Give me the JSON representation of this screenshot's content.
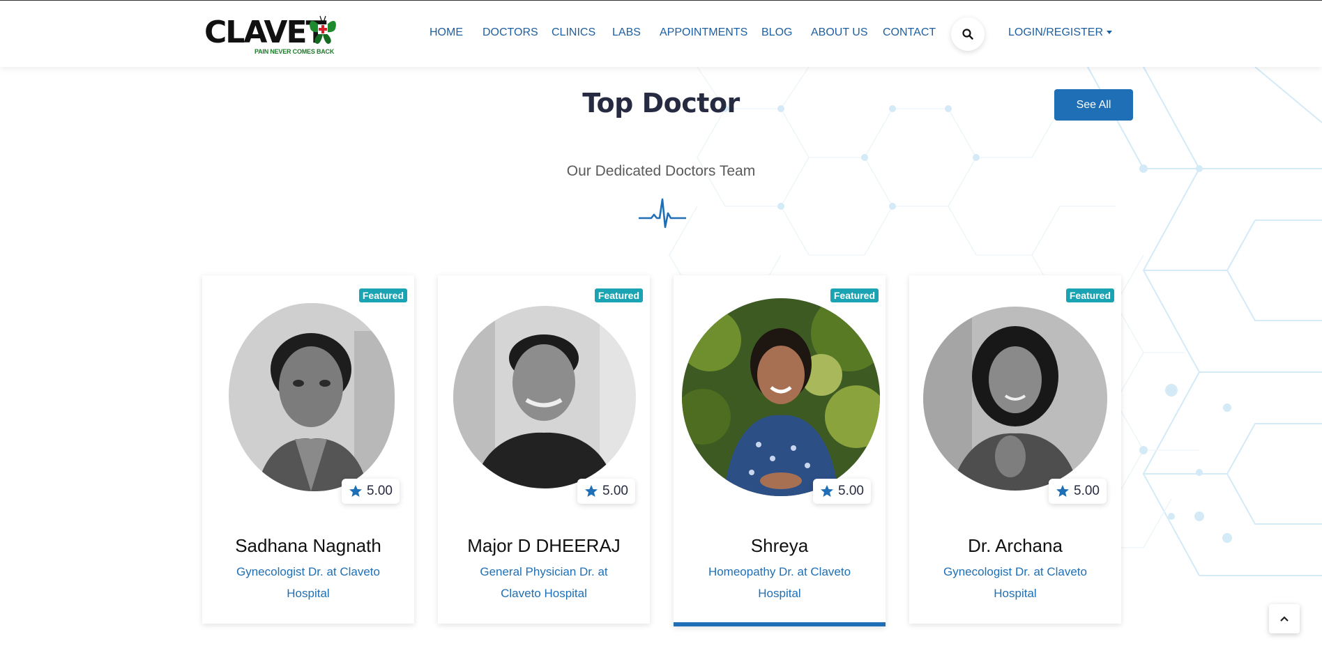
{
  "brand": {
    "name": "CLAVET",
    "tagline": "PAIN NEVER COMES BACK"
  },
  "nav": {
    "items": [
      {
        "label": "HOME"
      },
      {
        "label": "DOCTORS"
      },
      {
        "label": "CLINICS"
      },
      {
        "label": "LABS"
      },
      {
        "label": "APPOINTMENTS"
      },
      {
        "label": "BLOG"
      },
      {
        "label": "ABOUT US"
      },
      {
        "label": "CONTACT"
      }
    ],
    "search_icon": "search-icon",
    "login_label": "LOGIN/REGISTER"
  },
  "section": {
    "title": "Top Doctor",
    "subtitle": "Our Dedicated Doctors Team",
    "see_all_label": "See All"
  },
  "doctors": [
    {
      "badge": "Featured",
      "rating": "5.00",
      "name": "Sadhana Nagnath",
      "specialty": "Gynecologist Dr. at Claveto Hospital",
      "photo_style": "grayscale"
    },
    {
      "badge": "Featured",
      "rating": "5.00",
      "name": "Major D DHEERAJ",
      "specialty": "General Physician Dr. at Claveto Hospital",
      "photo_style": "grayscale"
    },
    {
      "badge": "Featured",
      "rating": "5.00",
      "name": "Shreya",
      "specialty": "Homeopathy Dr. at Claveto Hospital",
      "photo_style": "color"
    },
    {
      "badge": "Featured",
      "rating": "5.00",
      "name": "Dr. Archana",
      "specialty": "Gynecologist Dr. at Claveto Hospital",
      "photo_style": "grayscale"
    }
  ],
  "colors": {
    "primary": "#1e6fb5",
    "nav_text": "#1e5f9f",
    "badge": "#1aa3b2",
    "heading": "#272b41"
  },
  "scroll_top_icon": "chevron-up-icon"
}
